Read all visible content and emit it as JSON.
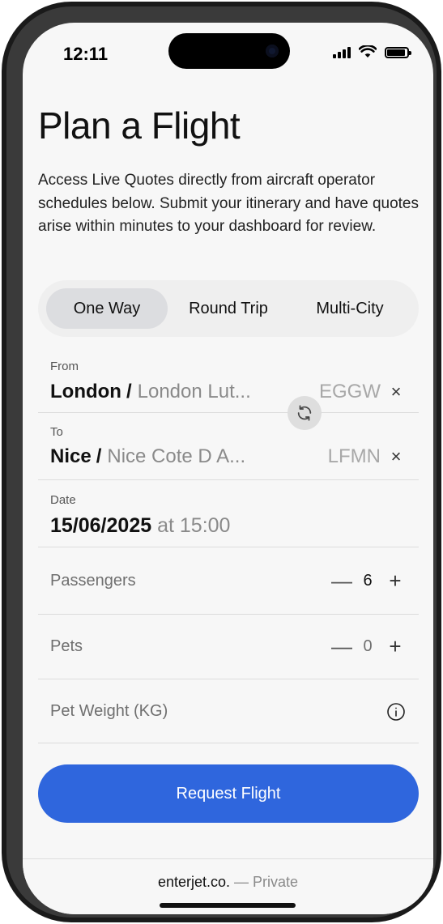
{
  "status_bar": {
    "time": "12:11"
  },
  "page": {
    "title": "Plan a Flight",
    "intro": "Access Live Quotes directly from aircraft operator schedules below. Submit your itinerary and have quotes arise within minutes to your dashboard for review."
  },
  "trip_type": {
    "options": [
      "One Way",
      "Round Trip",
      "Multi-City"
    ],
    "selected": "One Way"
  },
  "from": {
    "label": "From",
    "city": "London",
    "separator": "/",
    "airport": "London Lut...",
    "code": "EGGW",
    "clear": "×"
  },
  "to": {
    "label": "To",
    "city": "Nice",
    "separator": "/",
    "airport": "Nice Cote D A...",
    "code": "LFMN",
    "clear": "×"
  },
  "swap_icon": "swap-arrows-icon",
  "date": {
    "label": "Date",
    "date": "15/06/2025",
    "time_prefix": "at",
    "time": "15:00"
  },
  "passengers": {
    "label": "Passengers",
    "minus": "—",
    "value": "6",
    "plus": "+"
  },
  "pets": {
    "label": "Pets",
    "minus": "—",
    "value": "0",
    "plus": "+"
  },
  "pet_weight": {
    "label": "Pet Weight (KG)",
    "icon": "info-icon"
  },
  "actions": {
    "request_label": "Request Flight"
  },
  "footer": {
    "brand": "enterjet.co.",
    "rest": " — Private"
  },
  "colors": {
    "accent": "#2f66dd",
    "background": "#f7f7f7",
    "segment_active": "#dcdde0"
  }
}
